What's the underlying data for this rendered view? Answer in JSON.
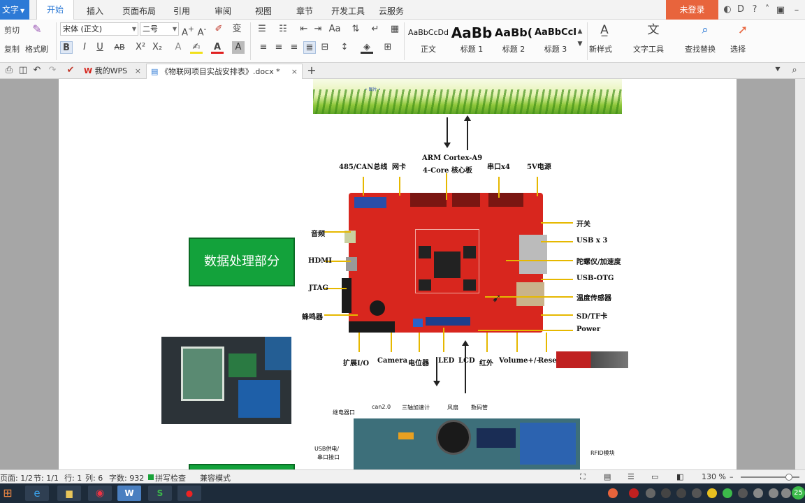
{
  "app": {
    "menu_label": "文字",
    "login_label": "未登录"
  },
  "tabs": [
    {
      "label": "开始"
    },
    {
      "label": "插入"
    },
    {
      "label": "页面布局"
    },
    {
      "label": "引用"
    },
    {
      "label": "审阅"
    },
    {
      "label": "视图"
    },
    {
      "label": "章节"
    },
    {
      "label": "开发工具"
    },
    {
      "label": "云服务"
    }
  ],
  "ribbon": {
    "cut": "剪切",
    "copy": "复制",
    "format_painter": "格式刷",
    "font_name": "宋体 (正文)",
    "font_size": "二号",
    "styles": [
      {
        "sample": "AaBbCcDd",
        "name": "正文"
      },
      {
        "sample": "AaBb",
        "name": "标题 1"
      },
      {
        "sample": "AaBb(",
        "name": "标题 2"
      },
      {
        "sample": "AaBbCcI",
        "name": "标题 3"
      }
    ],
    "new_style": "新样式",
    "text_tools": "文字工具",
    "find_replace": "查找替换",
    "select": "选择"
  },
  "doc_tabs": [
    {
      "label": "我的WPS"
    },
    {
      "label": "《物联网项目实战安排表》.docx *"
    }
  ],
  "document": {
    "data_section_label": "数据处理部分",
    "grass_tiny_text": "• 图片 •",
    "board_labels": {
      "can": "485/CAN总线",
      "net": "网卡",
      "arm": "ARM Cortex-A9",
      "arm2": "4-Core 核心板",
      "serial": "串口x4",
      "power5v": "5V电源",
      "switch": "开关",
      "usb3": "USB x 3",
      "gyro": "陀螺仪/加速度",
      "otg": "USB-OTG",
      "temp": "温度传感器",
      "sd": "SD/TF卡",
      "power": "Power",
      "audio": "音频",
      "hdmi": "HDMI",
      "jtag": "JTAG",
      "buzzer": "蜂鸣器",
      "io": "扩展I/O",
      "camera": "Camera",
      "pot": "电位器",
      "led": "LED",
      "lcd": "LCD",
      "ir": "红外",
      "volume": "Volume+/-",
      "reset": "Reset"
    },
    "module_labels": {
      "relay": "继电器口",
      "can2": "can2.0",
      "accel": "三轴加速计",
      "fan": "风扇",
      "tube": "数码管",
      "usb_power": "USB供电/",
      "serial_port": "串口接口",
      "rfid": "RFID模块"
    }
  },
  "status": {
    "page": "页面: 1/2",
    "section": "节: 1/1",
    "row": "行: 1",
    "col": "列: 6",
    "words": "字数: 932",
    "spell": "拼写检查",
    "compat": "兼容模式",
    "zoom": "130 %",
    "zoom_fraction": 0.82
  },
  "taskbar": {
    "clock_badge": "25"
  },
  "colors": {
    "accent": "#2d7ad6",
    "login": "#e8643c",
    "board_red": "#d8261e",
    "green_box": "#13a23b"
  }
}
